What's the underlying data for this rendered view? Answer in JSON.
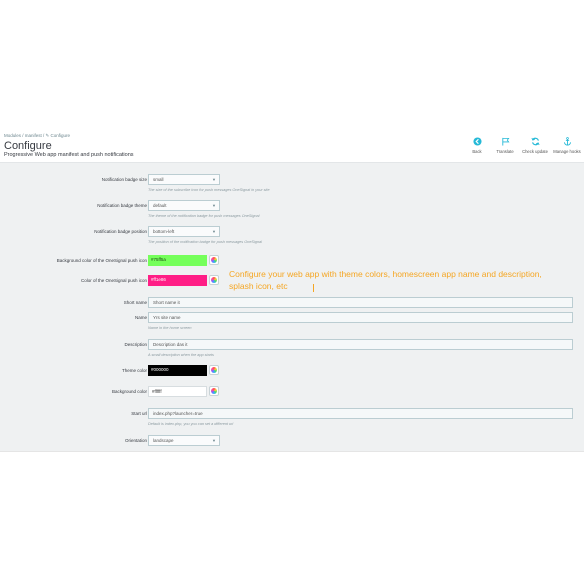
{
  "breadcrumb": "Modules  /  manifest  /  ✎ Configure",
  "page_title": "Configure",
  "page_subtitle": "Progressive Web app manifest and push notifications",
  "toolbar": {
    "back": "Back",
    "translate": "Translate",
    "check_update": "Check update",
    "manage_hooks": "Manage hooks"
  },
  "form": {
    "badge_size": {
      "label": "Notification badge size",
      "value": "small",
      "help": "The size of the subscribe icon for push messages OneSignal in your site"
    },
    "badge_theme": {
      "label": "Notification badge theme",
      "value": "default",
      "help": "The theme of the notification badge for push messages OneSignal"
    },
    "badge_position": {
      "label": "Notification badge position",
      "value": "bottom-left",
      "help": "The position of the notification badge for push messages OneSignal"
    },
    "bg_color_push": {
      "label": "Background color of the OneSignal push icon",
      "value": "#75ff5a"
    },
    "color_push": {
      "label": "Color of the OneSignal push icon",
      "value": "#ff1e86"
    },
    "short_name": {
      "label": "Short name",
      "value": "Short name it"
    },
    "name": {
      "label": "Name",
      "value": "Yrs site name",
      "help": "Name in the home screen"
    },
    "description": {
      "label": "Description",
      "value": "Description das it",
      "help": "A small description when the app starts"
    },
    "theme_color": {
      "label": "Theme color",
      "value": "#000000"
    },
    "background_color": {
      "label": "Background color",
      "value": "#ffffff"
    },
    "start_url": {
      "label": "Start url",
      "value": "index.php?launcher=true",
      "help": "Default is index.php, you you can set a different url"
    },
    "orientation": {
      "label": "Orientation",
      "value": "landscape"
    }
  },
  "callout": "Configure your web app with theme colors, homescreen app name and description, splash icon, etc",
  "colors": {
    "accent_blue": "#25b9d7",
    "callout_orange": "#f5a623"
  }
}
